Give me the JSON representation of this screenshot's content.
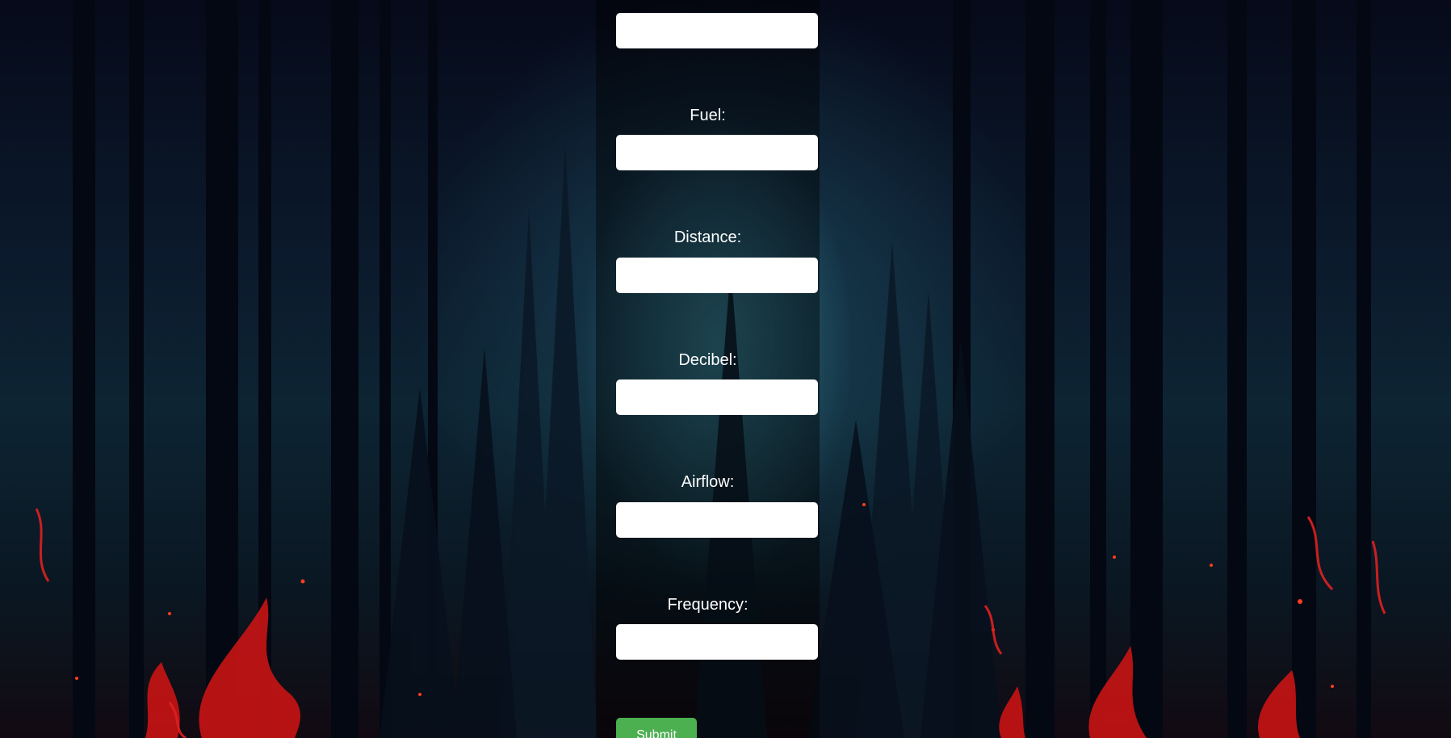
{
  "form": {
    "fields": [
      {
        "label": "",
        "value": ""
      },
      {
        "label": "Fuel:",
        "value": ""
      },
      {
        "label": "Distance:",
        "value": ""
      },
      {
        "label": "Decibel:",
        "value": ""
      },
      {
        "label": "Airflow:",
        "value": ""
      },
      {
        "label": "Frequency:",
        "value": ""
      }
    ],
    "submit_label": "Submit"
  },
  "colors": {
    "panel": "#000000",
    "input_bg": "#ffffff",
    "submit_bg": "#4caf50",
    "label_text": "#ffffff"
  }
}
